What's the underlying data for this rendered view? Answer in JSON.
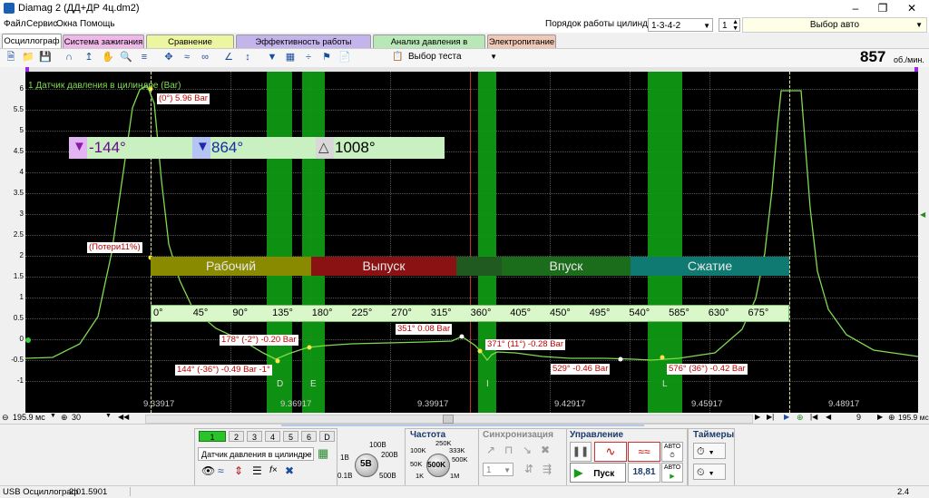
{
  "window": {
    "title": "Diamag 2 (ДД+ДР 4ц.dm2)"
  },
  "menu": [
    "Файл",
    "Сервис",
    "Окна",
    "Помощь"
  ],
  "header": {
    "cyl_order_label": "Порядок работы цилиндров",
    "cyl_order_value": "1-3-4-2",
    "cyl_num": "1",
    "auto_select": "Выбор авто"
  },
  "tabs": [
    {
      "label": "Осциллограф",
      "color": "#ffffff"
    },
    {
      "label": "Система зажигания",
      "color": "#f0b8e8"
    },
    {
      "label": "Сравнение цилиндров",
      "color": "#ecf5a0"
    },
    {
      "label": "Эффективность работы цилиндров",
      "color": "#c4b4ec"
    },
    {
      "label": "Анализ давления в цилиндре",
      "color": "#b8e8b8"
    },
    {
      "label": "Электропитание",
      "color": "#f0c8b8"
    }
  ],
  "toolbar": {
    "test_select": "Выбор теста",
    "rpm": "857",
    "rpm_unit": "об./мин."
  },
  "scope": {
    "channel_title": "1 Датчик давления в цилиндре (Bar)",
    "y_ticks": [
      "6",
      "5.5",
      "5",
      "4.5",
      "4",
      "3.5",
      "3",
      "2.5",
      "2",
      "1.5",
      "1",
      "0.5",
      "0",
      "-0.5",
      "-1"
    ],
    "x_ticks": [
      "9.33917",
      "9.36917",
      "9.39917",
      "9.42917",
      "9.45917",
      "9.48917"
    ],
    "cursors": {
      "left": "-144°",
      "right": "864°",
      "delta": "1008°"
    },
    "phases": [
      "Рабочий",
      "Выпуск",
      "Впуск",
      "Сжатие"
    ],
    "degree_scale": [
      "0°",
      "45°",
      "90°",
      "135°",
      "180°",
      "225°",
      "270°",
      "315°",
      "360°",
      "405°",
      "450°",
      "495°",
      "540°",
      "585°",
      "630°",
      "675°"
    ],
    "markers": [
      "D",
      "E",
      "I",
      "L"
    ],
    "labels": {
      "peak": "(0°) 5.96 Bar",
      "loss": "(Потери11%)",
      "p178": "178° (-2°) -0.20 Bar",
      "p144": "144° (-36°) -0.49 Bar -1°",
      "p351": "351° 0.08 Bar",
      "p371": "371° (11°) -0.28 Bar",
      "p529": "529° -0.46 Bar",
      "p576": "576° (36°) -0.42 Bar"
    },
    "colors": {
      "background": "#000000",
      "trace": "#7fdc4f",
      "green_bar": "#0f9d14"
    }
  },
  "scroll": {
    "timebase": "195.9 мс",
    "divs": "30",
    "page": "9",
    "right_time": "195.9 мс"
  },
  "bottom": {
    "channels": [
      "1",
      "2",
      "3",
      "4",
      "5",
      "6",
      "D"
    ],
    "sensor": "Датчик давления в цилиндре",
    "voltage_title": "5В",
    "voltage_ticks": [
      "1В",
      "100В",
      "0.1В",
      "200В",
      "500В"
    ],
    "freq_title": "Частота",
    "freq_value": "500K",
    "freq_ticks": [
      "250K",
      "100K",
      "333K",
      "50K",
      "500K",
      "1K",
      "1M"
    ],
    "sync_title": "Синхронизация",
    "sync_value": "1",
    "control_title": "Управление",
    "start_label": "Пуск",
    "counter": "18,81",
    "auto_label": "АВТО",
    "timers_title": "Таймеры"
  },
  "status": {
    "app": "USB Осциллограф",
    "version": "2.01.5901",
    "right": "2.4"
  }
}
